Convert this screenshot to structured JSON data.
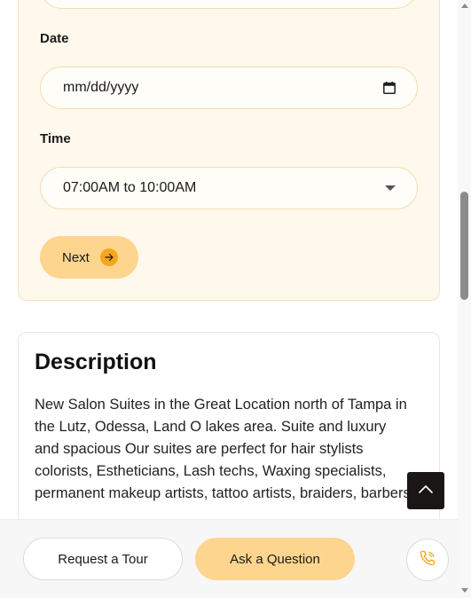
{
  "form": {
    "date": {
      "label": "Date",
      "placeholder": "mm/dd/yyyy"
    },
    "time": {
      "label": "Time",
      "selected": "07:00AM to 10:00AM"
    },
    "next_label": "Next"
  },
  "description": {
    "title": "Description",
    "text": "New Salon Suites in the Great Location north of Tampa in the Lutz, Odessa, Land O lakes area. Suite and luxury and spacious Our suites are perfect for hair stylists colorists, Estheticians, Lash techs, Waxing specialists, permanent makeup artists, tattoo artists, braiders, barbers"
  },
  "actions": {
    "request_tour": "Request a Tour",
    "ask_question": "Ask a Question"
  },
  "colors": {
    "accent": "#fdd58f",
    "accent_dark": "#f6a51d",
    "form_bg": "#fff8ec"
  },
  "icons": {
    "date": "calendar-icon",
    "time": "caret-down-icon",
    "next": "arrow-right-circle-icon",
    "to_top": "chevron-up-icon",
    "call": "phone-icon"
  }
}
